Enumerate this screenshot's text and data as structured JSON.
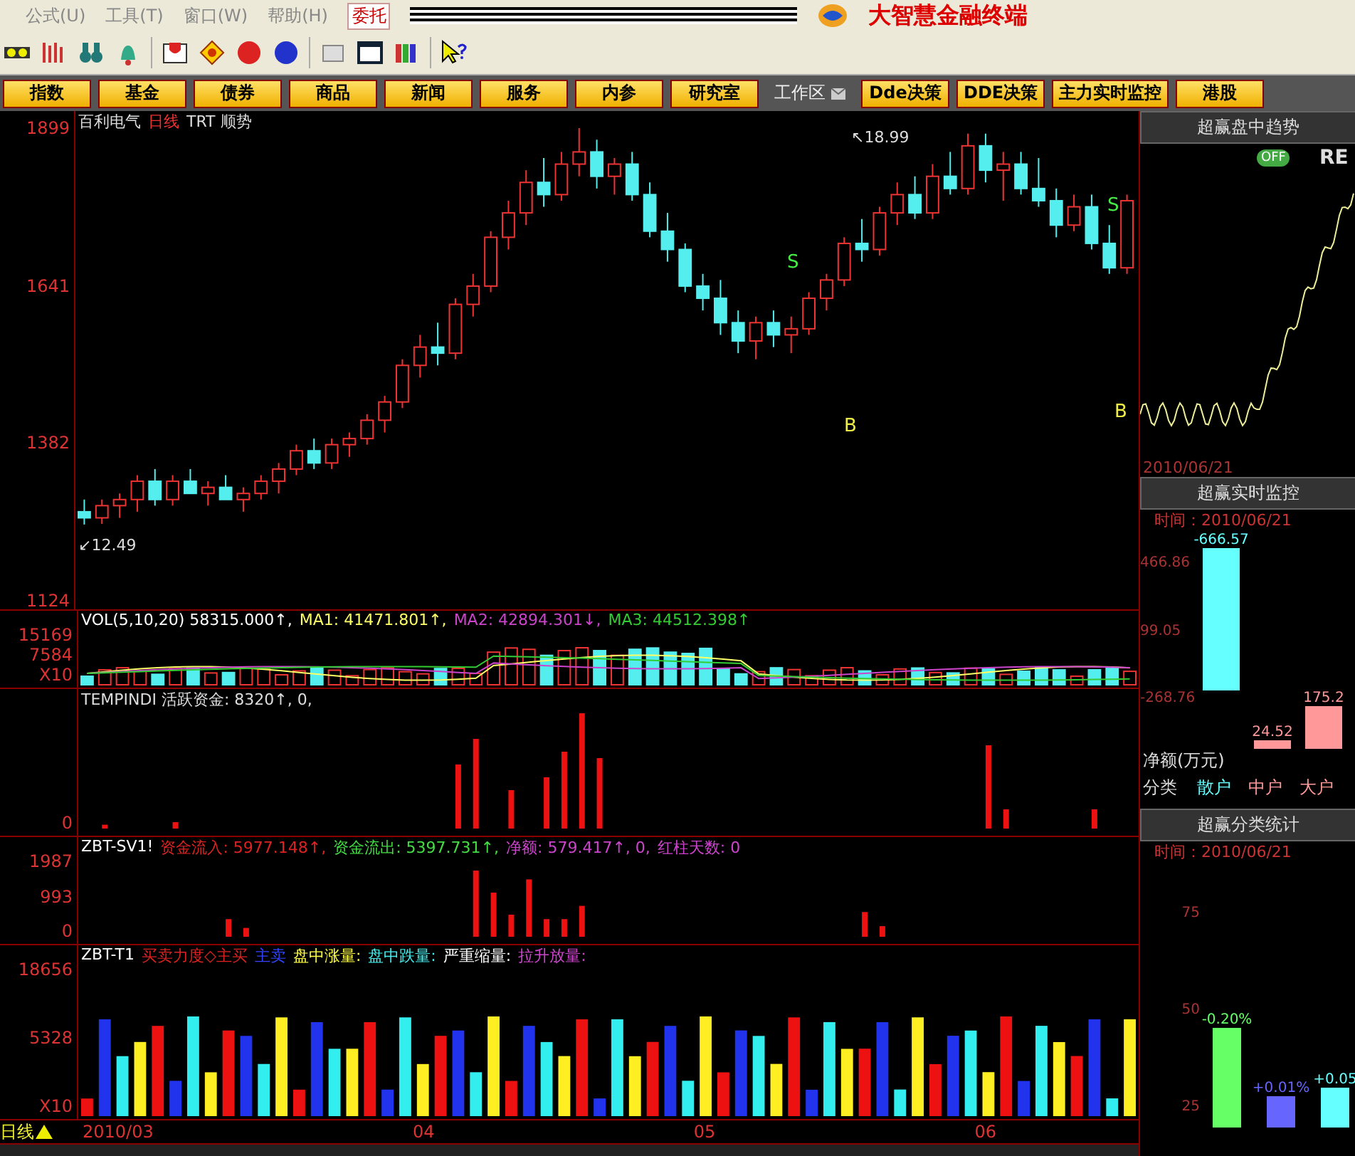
{
  "menu": {
    "items": [
      "公式(U)",
      "工具(T)",
      "窗口(W)",
      "帮助(H)"
    ],
    "order_tab": "委托",
    "app_title": "大智慧金融终端"
  },
  "nav_buttons": [
    {
      "label": "指数",
      "kind": "button"
    },
    {
      "label": "基金",
      "kind": "button"
    },
    {
      "label": "债券",
      "kind": "button"
    },
    {
      "label": "商品",
      "kind": "button"
    },
    {
      "label": "新闻",
      "kind": "button"
    },
    {
      "label": "服务",
      "kind": "button"
    },
    {
      "label": "内参",
      "kind": "button"
    },
    {
      "label": "研究室",
      "kind": "button"
    },
    {
      "label": "工作区",
      "kind": "workspace"
    },
    {
      "label": "Dde决策",
      "kind": "button"
    },
    {
      "label": "DDE决策",
      "kind": "button"
    },
    {
      "label": "主力实时监控",
      "kind": "button"
    },
    {
      "label": "港股",
      "kind": "button"
    }
  ],
  "price_panel": {
    "stock": "百利电气",
    "period": "日线",
    "indicator": "TRT 顺势",
    "low_mark": "↙12.49",
    "high_mark": "↖18.99",
    "chart_data": {
      "type": "candlestick",
      "categories": [
        null,
        null,
        null,
        null,
        null,
        null,
        null,
        null,
        null,
        null,
        null,
        null,
        null,
        null,
        null,
        null,
        null,
        null,
        null,
        null,
        null,
        null,
        null,
        null,
        null,
        null,
        null,
        null,
        null,
        null,
        null,
        null,
        null,
        null,
        null,
        null,
        null,
        null,
        null,
        null,
        null,
        null,
        null,
        null,
        null,
        null,
        null,
        null,
        null,
        null,
        null,
        null,
        null,
        null,
        null,
        null,
        null,
        null,
        null,
        null
      ],
      "ylim": [
        1110,
        1927
      ],
      "yticks": [
        1899,
        1641,
        1382,
        1124
      ],
      "ohlc": [
        [
          1270,
          1290,
          1249,
          1260
        ],
        [
          1260,
          1290,
          1250,
          1280
        ],
        [
          1280,
          1300,
          1260,
          1290
        ],
        [
          1290,
          1330,
          1270,
          1320
        ],
        [
          1320,
          1340,
          1280,
          1290
        ],
        [
          1290,
          1330,
          1280,
          1320
        ],
        [
          1320,
          1340,
          1300,
          1300
        ],
        [
          1300,
          1320,
          1280,
          1310
        ],
        [
          1310,
          1330,
          1290,
          1290
        ],
        [
          1290,
          1310,
          1270,
          1300
        ],
        [
          1300,
          1330,
          1290,
          1320
        ],
        [
          1320,
          1350,
          1300,
          1340
        ],
        [
          1340,
          1380,
          1330,
          1370
        ],
        [
          1370,
          1390,
          1340,
          1350
        ],
        [
          1350,
          1390,
          1340,
          1380
        ],
        [
          1380,
          1400,
          1360,
          1390
        ],
        [
          1390,
          1430,
          1380,
          1420
        ],
        [
          1420,
          1460,
          1400,
          1450
        ],
        [
          1450,
          1520,
          1440,
          1510
        ],
        [
          1510,
          1560,
          1490,
          1540
        ],
        [
          1540,
          1580,
          1510,
          1530
        ],
        [
          1530,
          1620,
          1520,
          1610
        ],
        [
          1610,
          1660,
          1590,
          1640
        ],
        [
          1640,
          1730,
          1630,
          1720
        ],
        [
          1720,
          1780,
          1700,
          1760
        ],
        [
          1760,
          1830,
          1740,
          1810
        ],
        [
          1810,
          1850,
          1770,
          1790
        ],
        [
          1790,
          1860,
          1780,
          1840
        ],
        [
          1840,
          1899,
          1820,
          1860
        ],
        [
          1860,
          1880,
          1800,
          1820
        ],
        [
          1820,
          1850,
          1790,
          1840
        ],
        [
          1840,
          1860,
          1780,
          1790
        ],
        [
          1790,
          1810,
          1720,
          1730
        ],
        [
          1730,
          1760,
          1680,
          1700
        ],
        [
          1700,
          1710,
          1630,
          1640
        ],
        [
          1640,
          1660,
          1600,
          1620
        ],
        [
          1620,
          1650,
          1560,
          1580
        ],
        [
          1580,
          1600,
          1530,
          1550
        ],
        [
          1550,
          1590,
          1520,
          1580
        ],
        [
          1580,
          1600,
          1540,
          1560
        ],
        [
          1560,
          1590,
          1530,
          1570
        ],
        [
          1570,
          1630,
          1560,
          1620
        ],
        [
          1620,
          1660,
          1600,
          1650
        ],
        [
          1650,
          1720,
          1640,
          1710
        ],
        [
          1710,
          1750,
          1680,
          1700
        ],
        [
          1700,
          1770,
          1690,
          1760
        ],
        [
          1760,
          1810,
          1740,
          1790
        ],
        [
          1790,
          1820,
          1750,
          1760
        ],
        [
          1760,
          1840,
          1750,
          1820
        ],
        [
          1820,
          1860,
          1790,
          1800
        ],
        [
          1800,
          1890,
          1790,
          1870
        ],
        [
          1870,
          1890,
          1810,
          1830
        ],
        [
          1830,
          1860,
          1780,
          1840
        ],
        [
          1840,
          1860,
          1790,
          1800
        ],
        [
          1800,
          1850,
          1770,
          1780
        ],
        [
          1780,
          1800,
          1720,
          1740
        ],
        [
          1740,
          1790,
          1730,
          1770
        ],
        [
          1770,
          1790,
          1700,
          1710
        ],
        [
          1710,
          1740,
          1660,
          1670
        ],
        [
          1670,
          1790,
          1660,
          1780
        ]
      ]
    },
    "signals": [
      {
        "label": "S"
      },
      {
        "label": "S"
      },
      {
        "label": "B"
      },
      {
        "label": "B"
      }
    ]
  },
  "volume_panel": {
    "axis": [
      "15169",
      "7584",
      "X10"
    ],
    "legend": [
      {
        "text": "VOL(5,10,20) 58315.000↑,",
        "color": "#ffffff"
      },
      {
        "text": "MA1: 41471.801↑,",
        "color": "#ffff66"
      },
      {
        "text": "MA2: 42894.301↓,",
        "color": "#cc44cc"
      },
      {
        "text": "MA3: 44512.398↑",
        "color": "#33cc33"
      }
    ]
  },
  "active_funds_panel": {
    "axis": [
      "0"
    ],
    "legend": [
      {
        "text": "TEMPINDI 活跃资金: 8320↑, 0,",
        "color": "#dddddd"
      }
    ]
  },
  "fund_flow_panel": {
    "axis": [
      "1987",
      "993",
      "0"
    ],
    "legend": [
      {
        "text": "ZBT-SV1!",
        "color": "#ffffff"
      },
      {
        "text": "资金流入: 5977.148↑,",
        "color": "#dd2222"
      },
      {
        "text": "资金流出: 5397.731↑,",
        "color": "#44dd44"
      },
      {
        "text": "净额: 579.417↑, 0,",
        "color": "#cc44cc"
      },
      {
        "text": "红柱天数: 0",
        "color": "#cc44cc"
      }
    ]
  },
  "trade_force_panel": {
    "axis": [
      "18656",
      "5328",
      "X10"
    ],
    "legend": [
      {
        "text": "ZBT-T1",
        "color": "#ffffff"
      },
      {
        "text": "买卖力度◇主买",
        "color": "#dd2222"
      },
      {
        "text": "主卖",
        "color": "#3344ff"
      },
      {
        "text": "盘中涨量:",
        "color": "#ffff44"
      },
      {
        "text": "盘中跌量:",
        "color": "#44eeee"
      },
      {
        "text": "严重缩量:",
        "color": "#ffffff"
      },
      {
        "text": "拉升放量:",
        "color": "#cc44cc"
      }
    ]
  },
  "date_axis": {
    "period": "日线",
    "labels": [
      "2010/03",
      "04",
      "05",
      "06"
    ]
  },
  "side_panel": {
    "trend": {
      "title": "超赢盘中趋势",
      "badge": "OFF",
      "badge_text": "RE",
      "date": "2010/06/21"
    },
    "monitor": {
      "title": "超赢实时监控",
      "time": "时间：2010/06/21",
      "axis": [
        "466.86",
        "99.05",
        "-268.76"
      ],
      "bars": [
        {
          "label": "-666.57",
          "category": "散户"
        },
        {
          "label": "24.52",
          "category": "中户"
        },
        {
          "label": "175.2",
          "category": "大户"
        }
      ],
      "unit": "净额(万元)",
      "category_label": "分类"
    },
    "stats": {
      "title": "超赢分类统计",
      "time": "时间：2010/06/21",
      "axis": [
        "75",
        "50",
        "25"
      ],
      "bars": [
        {
          "label": "-0.20%"
        },
        {
          "label": "+0.01%"
        },
        {
          "label": "+0.05"
        }
      ]
    }
  }
}
